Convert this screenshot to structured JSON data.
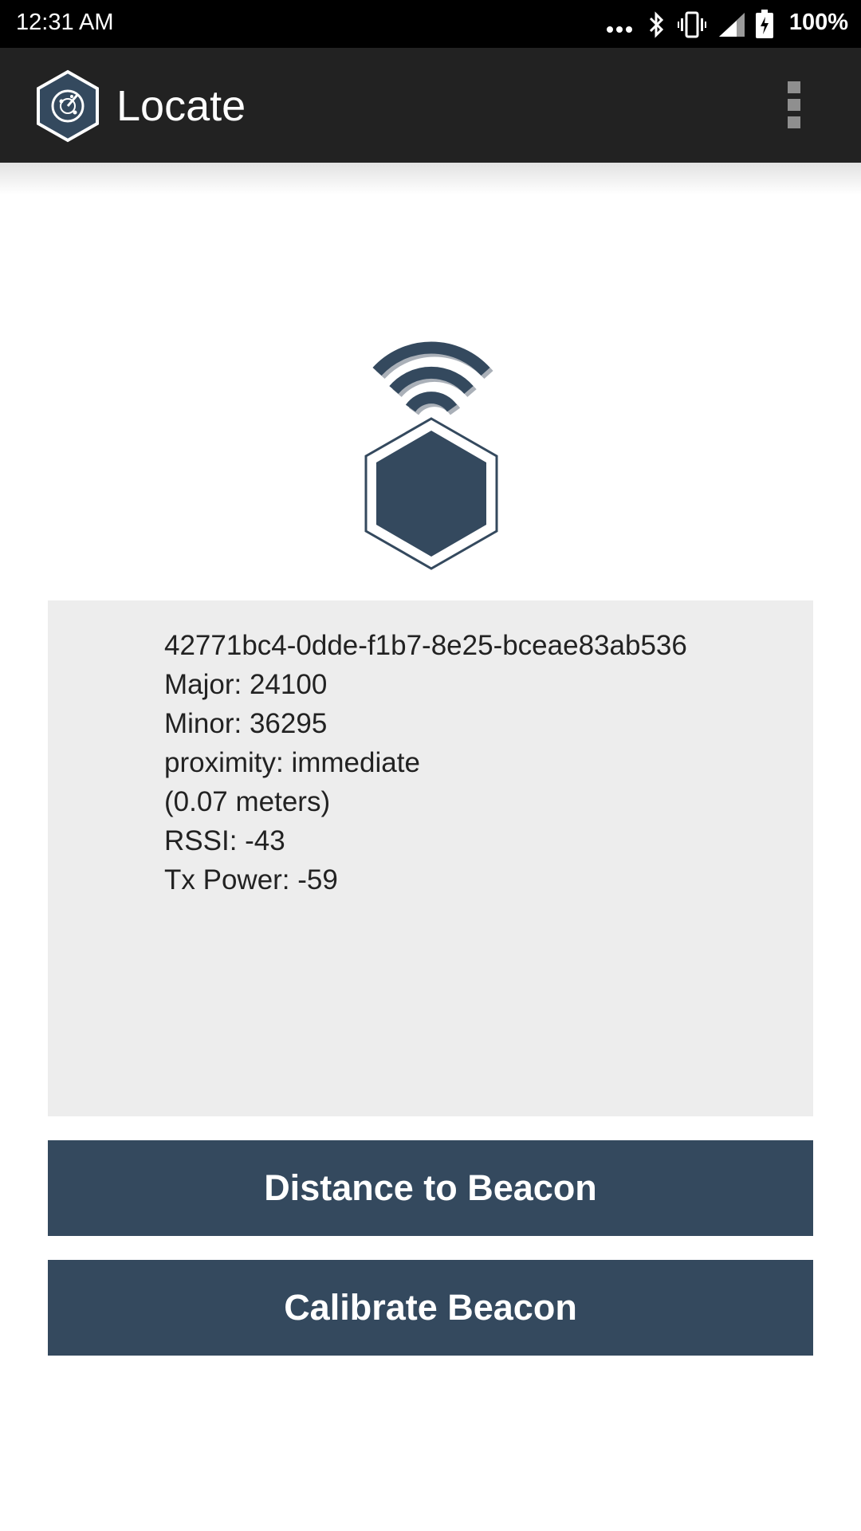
{
  "status_bar": {
    "time": "12:31 AM",
    "battery_text": "100%",
    "icons": [
      "more-dots-icon",
      "bluetooth-icon",
      "vibrate-icon",
      "signal-icon",
      "battery-charging-icon"
    ]
  },
  "app_bar": {
    "title": "Locate",
    "logo_icon": "radar-hexagon-logo",
    "menu_icon": "overflow-menu-icon",
    "background_color": "#222222"
  },
  "beacon": {
    "icon": "beacon-broadcast-icon",
    "uuid": "42771bc4-0dde-f1b7-8e25-bceae83ab536",
    "major": "Major: 24100",
    "minor": "Minor: 36295",
    "proximity": "proximity: immediate",
    "distance": "(0.07 meters)",
    "rssi": "RSSI: -43",
    "tx_power": "Tx Power: -59"
  },
  "actions": {
    "distance_label": "Distance to Beacon",
    "calibrate_label": "Calibrate Beacon",
    "button_color": "#34495e"
  }
}
